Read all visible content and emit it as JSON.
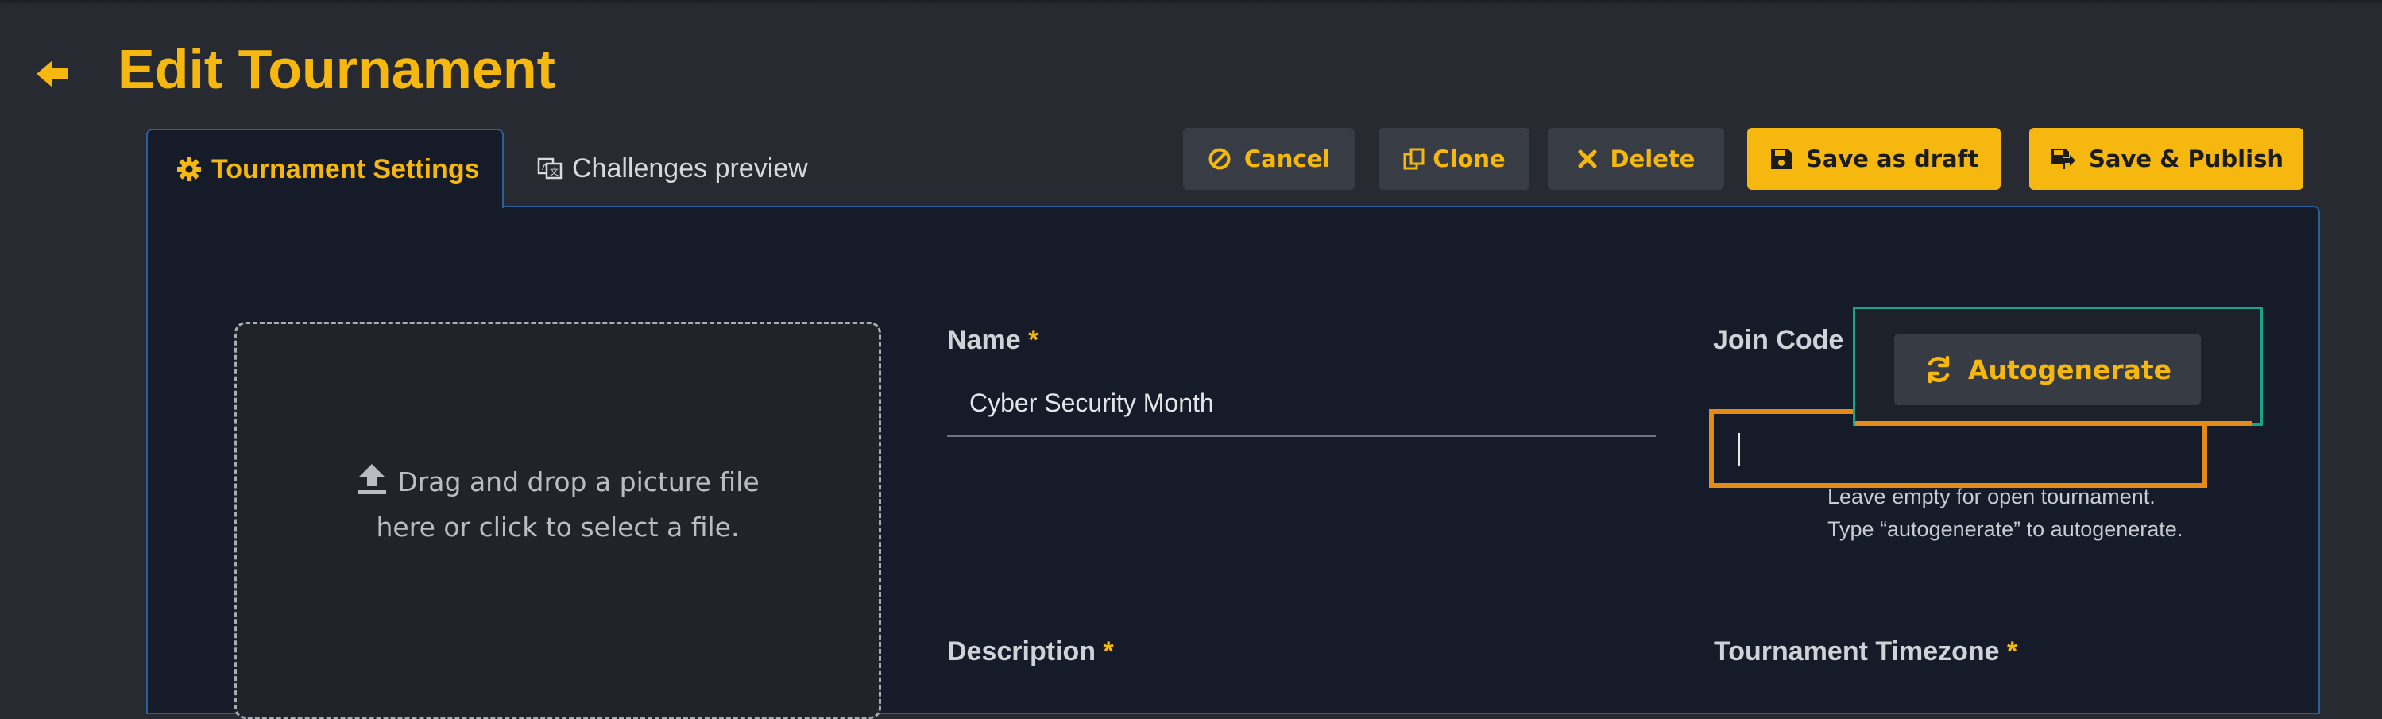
{
  "header": {
    "title": "Edit Tournament",
    "back_icon": "arrow-left-icon"
  },
  "tabs": [
    {
      "label": "Tournament Settings",
      "icon": "gear-icon",
      "active": true
    },
    {
      "label": "Challenges preview",
      "icon": "language-icon",
      "active": false
    }
  ],
  "toolbar": {
    "cancel": "Cancel",
    "clone": "Clone",
    "delete": "Delete",
    "save_draft": "Save as draft",
    "save_publish": "Save & Publish"
  },
  "dropzone": {
    "line1": "Drag and drop a picture file",
    "line2": "here or click to select a file."
  },
  "fields": {
    "name": {
      "label": "Name",
      "required": "*",
      "value": "Cyber Security Month"
    },
    "join_code": {
      "label": "Join Code",
      "value": "",
      "help1": "Leave empty for open tournament.",
      "help2": "Type “autogenerate” to autogenerate.",
      "autogenerate": "Autogenerate"
    },
    "description": {
      "label": "Description",
      "required": "*"
    },
    "timezone": {
      "label": "Tournament Timezone",
      "required": "*"
    }
  },
  "colors": {
    "accent": "#f6b80f",
    "background": "#272a30",
    "panel": "#151b29",
    "focus_border": "#e38a17",
    "popup_border": "#1aa58a"
  }
}
